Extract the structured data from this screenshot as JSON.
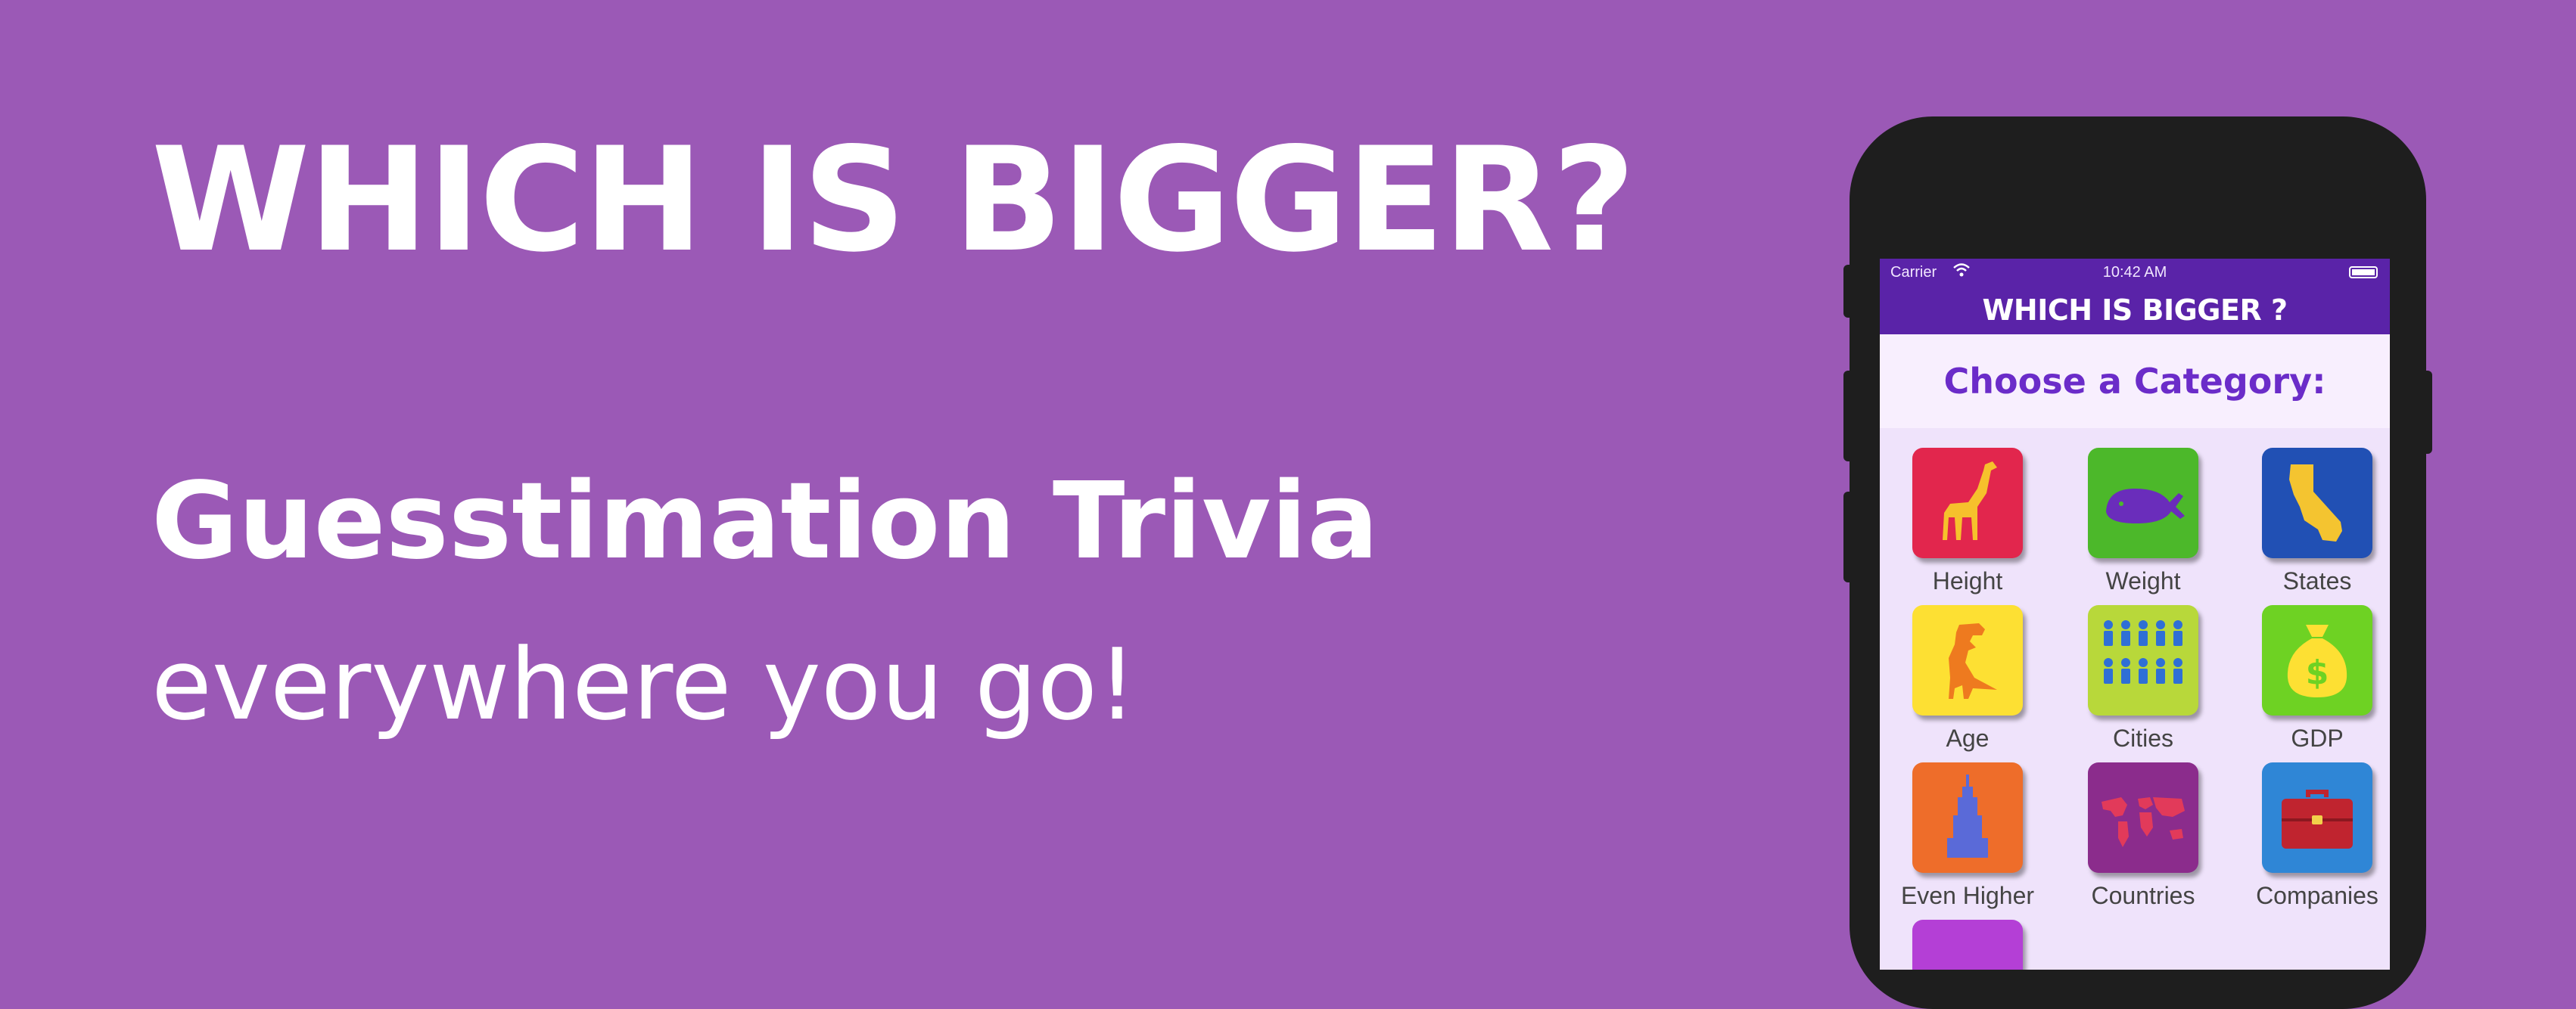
{
  "banner": {
    "headline": "WHICH IS BIGGER?",
    "subtitle": "Guesstimation Trivia",
    "tagline": "everywhere you go!"
  },
  "phone": {
    "status_bar": {
      "carrier": "Carrier",
      "time": "10:42 AM"
    },
    "nav_title": "WHICH IS BIGGER ?",
    "prompt": "Choose a Category:",
    "categories": [
      {
        "label": "Height",
        "icon": "giraffe-icon",
        "color": "#e2264d"
      },
      {
        "label": "Weight",
        "icon": "whale-icon",
        "color": "#4cb82a"
      },
      {
        "label": "States",
        "icon": "california-icon",
        "color": "#2150b4"
      },
      {
        "label": "Age",
        "icon": "dinosaur-icon",
        "color": "#fde033"
      },
      {
        "label": "Cities",
        "icon": "people-icon",
        "color": "#b8d83a"
      },
      {
        "label": "GDP",
        "icon": "money-bag-icon",
        "color": "#6ed223"
      },
      {
        "label": "Even Higher",
        "icon": "skyscraper-icon",
        "color": "#ee6d2a"
      },
      {
        "label": "Countries",
        "icon": "world-map-icon",
        "color": "#8b2c8c"
      },
      {
        "label": "Companies",
        "icon": "briefcase-icon",
        "color": "#2f86d6"
      }
    ]
  },
  "colors": {
    "background": "#9b59b6",
    "nav": "#5a23a8",
    "prompt_text": "#6b2cc9"
  }
}
